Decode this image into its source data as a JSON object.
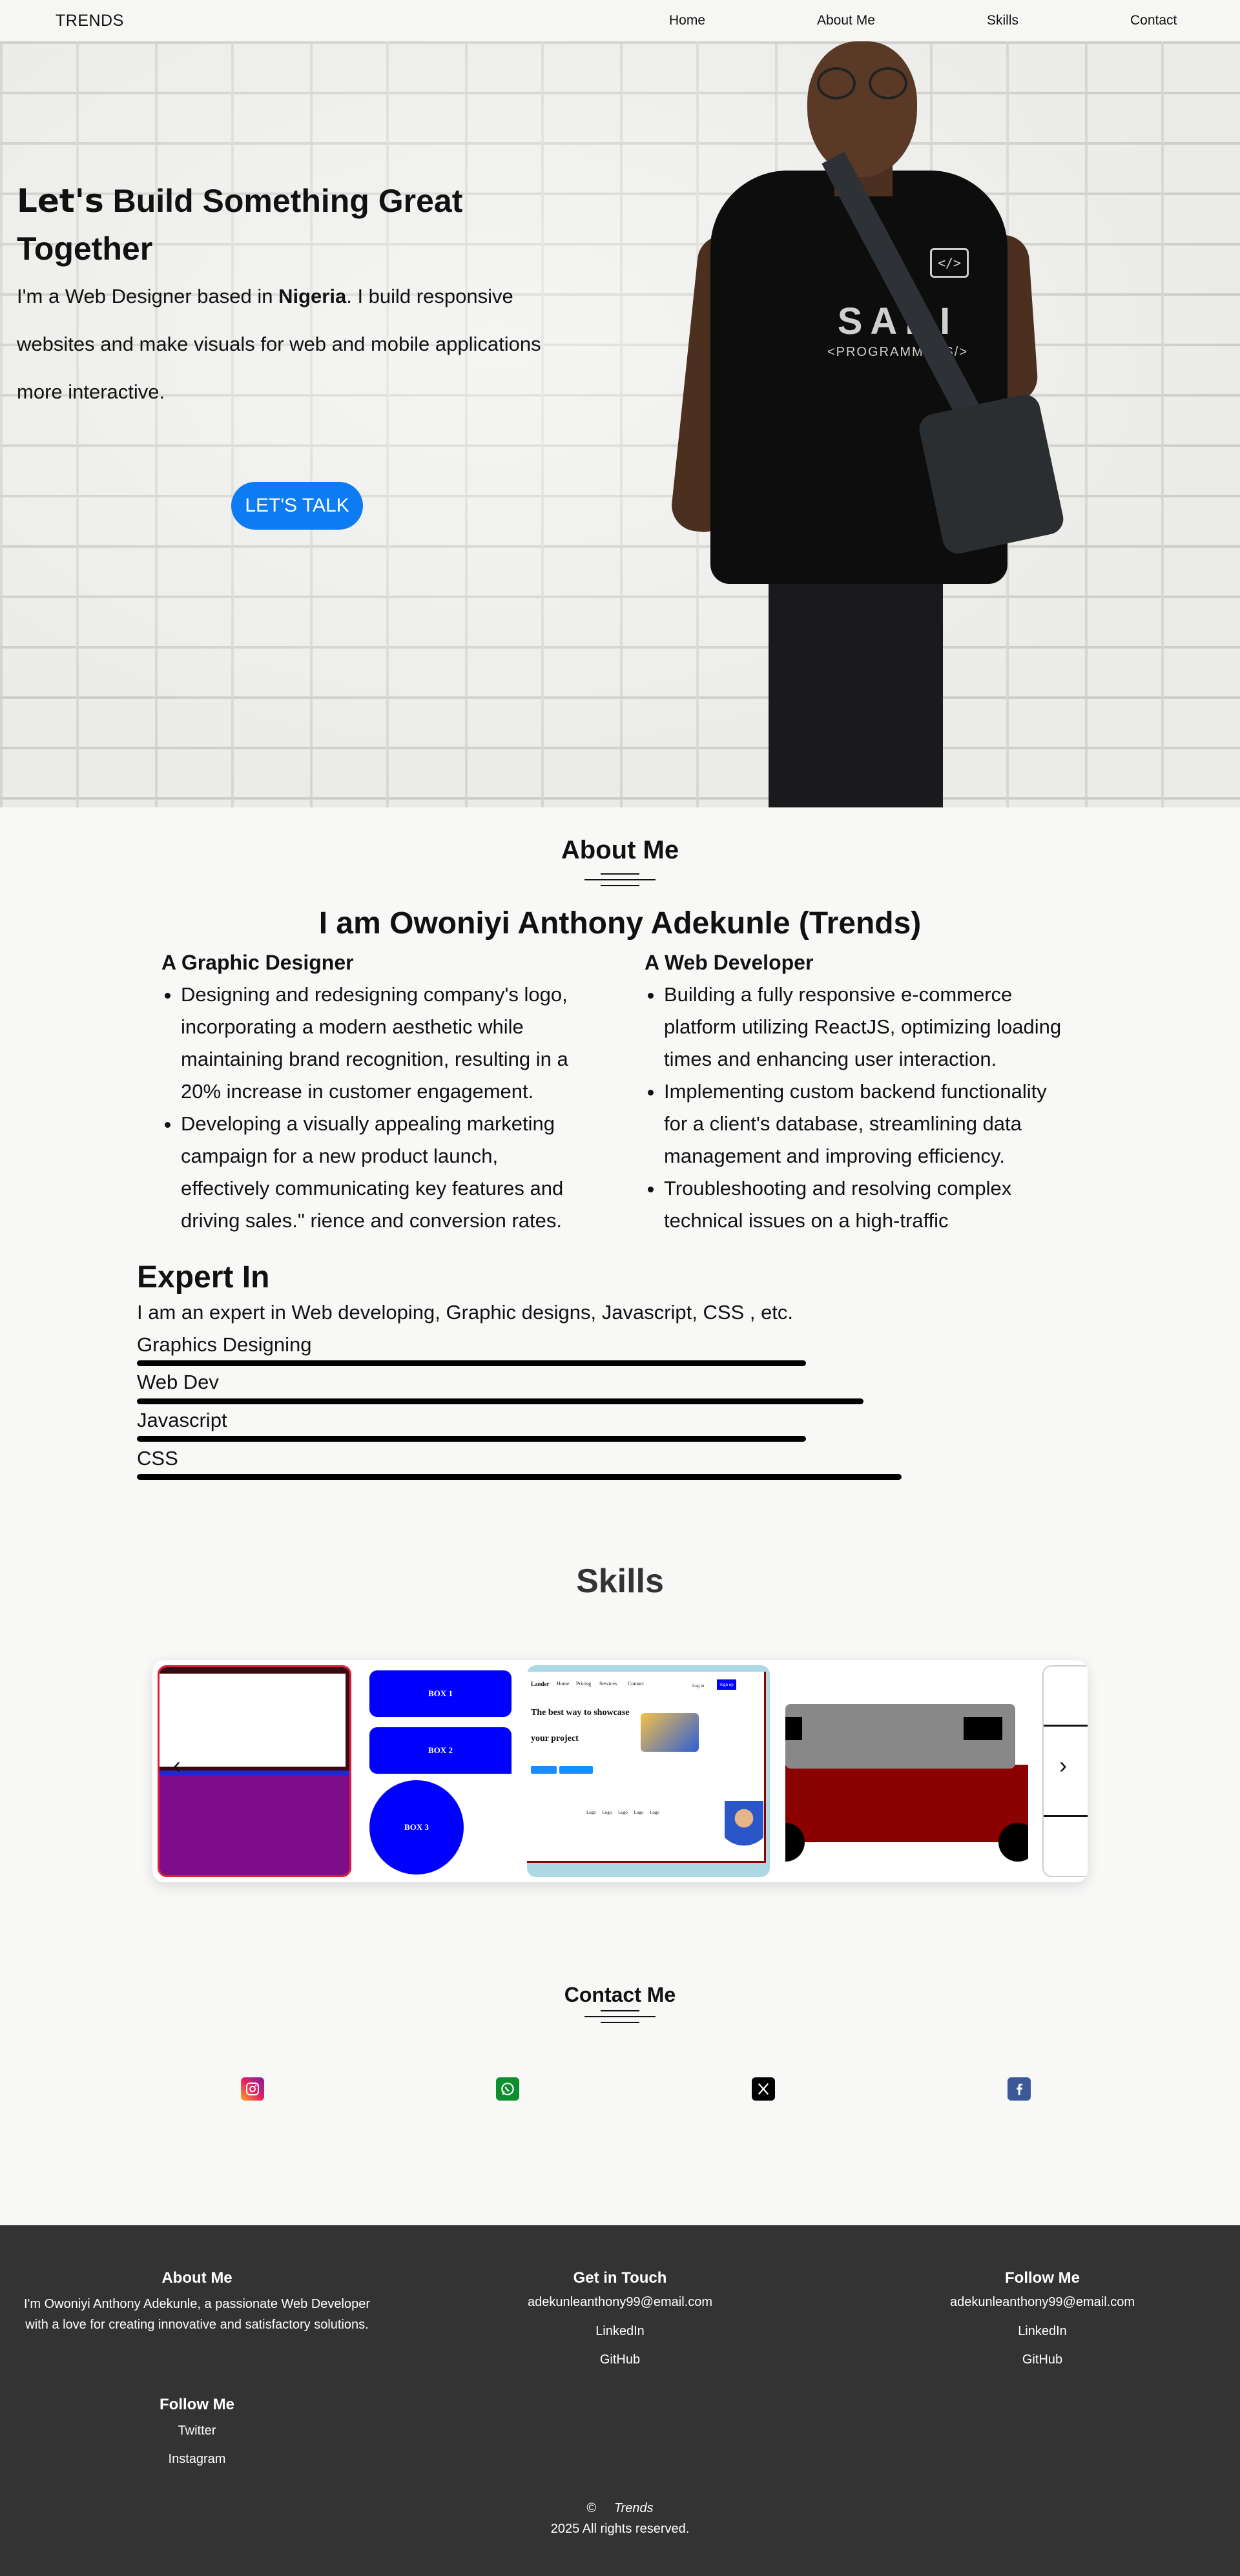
{
  "nav": {
    "brand": "TRENDS",
    "links": [
      "Home",
      "About Me",
      "Skills",
      "Contact"
    ]
  },
  "hero": {
    "title_lets": "Let's",
    "title_rest": " Build Something Great",
    "title_line2": "Together",
    "desc_pre": "I'm a Web Designer based in ",
    "desc_bold": "Nigeria",
    "desc_post": ". I build responsive",
    "desc_line2": "websites and make visuals for web and mobile applications",
    "desc_line3": "more interactive.",
    "cta": "LET'S TALK",
    "shirt_logo": "</>",
    "shirt_print": "SABI",
    "shirt_print2": "<PROGRAMMERS/>"
  },
  "about": {
    "title": "About Me",
    "name": "I am Owoniyi Anthony Adekunle (Trends)",
    "graphic": {
      "heading": "A Graphic Designer",
      "items": [
        "Designing and redesigning company's logo, incorporating a modern aesthetic while maintaining brand recognition, resulting in a 20% increase in customer engagement.",
        "Developing a visually appealing marketing campaign for a new product launch, effectively communicating key features and driving sales.\" rience and conversion rates."
      ]
    },
    "web": {
      "heading": "A Web Developer",
      "items": [
        "Building a fully responsive e-commerce platform utilizing ReactJS, optimizing loading times and enhancing user interaction.",
        "Implementing custom backend functionality for a client's database, streamlining data management and improving efficiency.",
        "Troubleshooting and resolving complex technical issues on a high-traffic"
      ]
    }
  },
  "expert": {
    "title": "Expert In",
    "desc": "I am an expert in Web developing, Graphic designs, Javascript, CSS , etc.",
    "skills": [
      {
        "label": "Graphics Designing",
        "level": 0.7
      },
      {
        "label": "Web Dev",
        "level": 0.76
      },
      {
        "label": "Javascript",
        "level": 0.7
      },
      {
        "label": "CSS",
        "level": 0.8
      }
    ]
  },
  "skills": {
    "title": "Skills",
    "boxes": [
      "BOX 1",
      "BOX 2",
      "BOX 3"
    ],
    "preview": {
      "nav_brand": "Lander",
      "nav_links": [
        "Home",
        "Pricing",
        "Services",
        "Contact"
      ],
      "login": "Log in",
      "signup": "Sign up",
      "heading": "The best way to showcase",
      "heading2": "your project",
      "btn1": "Get started",
      "btn2": "Learn more",
      "logos": [
        "Logo",
        "Logo",
        "Logo",
        "Logo",
        "Logo"
      ]
    },
    "prev_arrow": "‹",
    "next_arrow": "›"
  },
  "contact": {
    "title": "Contact Me",
    "icons": [
      "instagram-icon",
      "whatsapp-icon",
      "x-icon",
      "facebook-icon"
    ]
  },
  "footer": {
    "about_head": "About Me",
    "about_text": "I'm Owoniyi Anthony Adekunle, a passionate Web Developer with a love for creating innovative and satisfactory solutions.",
    "touch_head": "Get in Touch",
    "touch_email": "adekunleanthony99@email.com",
    "touch_links": [
      "LinkedIn",
      "GitHub"
    ],
    "follow_head": "Follow Me",
    "follow_email": "adekunleanthony99@email.com",
    "follow_links": [
      "LinkedIn",
      "GitHub"
    ],
    "follow2_head": "Follow Me",
    "follow2_links": [
      "Twitter",
      "Instagram"
    ],
    "copyright_symbol": "©",
    "copyright_brand": "Trends",
    "copyright_text": "2025 All rights reserved."
  }
}
